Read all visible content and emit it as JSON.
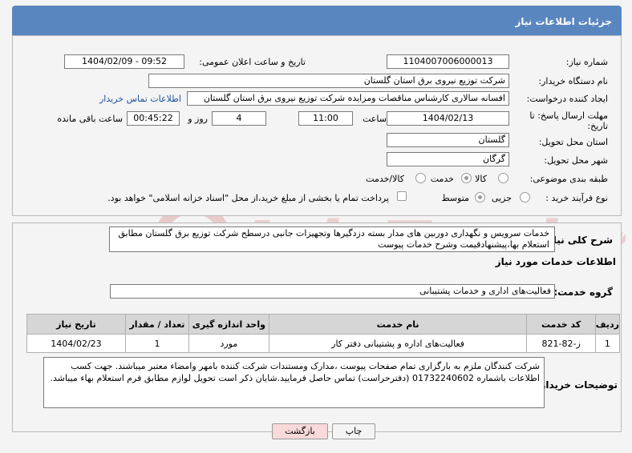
{
  "header": {
    "title": "جزئیات اطلاعات نیاز"
  },
  "form": {
    "need_number_label": "شماره نیاز:",
    "need_number": "1104007006000013",
    "announce_label": "تاریخ و ساعت اعلان عمومی:",
    "announce_value": "1404/02/09 - 09:52",
    "buyer_label": "نام دستگاه خریدار:",
    "buyer_value": "شرکت توزیع نیروی برق استان گلستان",
    "creator_label": "ایجاد کننده درخواست:",
    "creator_value": "افسانه سالاری کارشناس مناقصات ومزایده شرکت توزیع نیروی برق استان گلستان",
    "contact_link": "اطلاعات تماس خریدار",
    "deadline_label_1": "مهلت ارسال پاسخ: تا",
    "deadline_label_2": "تاریخ:",
    "deadline_date": "1404/02/13",
    "time_label": "ساعت",
    "deadline_time": "11:00",
    "days_value": "4",
    "days_label": "روز و",
    "remaining_time": "00:45:22",
    "remaining_label": "ساعت باقی مانده",
    "province_label": "استان محل تحویل:",
    "province_value": "گلستان",
    "city_label": "شهر محل تحویل:",
    "city_value": "گرگان",
    "category_label": "طبقه بندی موضوعی:",
    "category_options": [
      "کالا",
      "خدمت",
      "کالا/خدمت"
    ],
    "process_label": "نوع فرآیند خرید :",
    "process_options": [
      "جزیی",
      "متوسط"
    ],
    "payment_note": "پرداخت تمام یا بخشی از مبلغ خرید،از محل \"اسناد خزانه اسلامی\" خواهد بود."
  },
  "general": {
    "label": "شرح کلی نیاز:",
    "text": "خدمات سرویس و نگهداری دوربین های مدار بسته  دزدگیرها وتجهیزات جانبی درسطح شرکت توزیع برق گلستان مطابق استعلام بها،پیشنهادقیمت وشرح خدمات پیوست"
  },
  "services": {
    "section_title": "اطلاعات خدمات مورد نیاز",
    "group_label": "گروه خدمت:",
    "group_value": "فعالیت‌های اداری و خدمات پشتیبانی",
    "columns": [
      "ردیف",
      "کد خدمت",
      "نام خدمت",
      "واحد اندازه گیری",
      "تعداد / مقدار",
      "تاریخ نیاز"
    ],
    "rows": [
      [
        "1",
        "ز-82-821",
        "فعالیت‌های اداره و پشتیبانی دفتر کار",
        "مورد",
        "1",
        "1404/02/23"
      ]
    ]
  },
  "notes": {
    "label": "توضیحات خریدار:",
    "text": "شرکت کنندگان ملزم به بارگزاری تمام صفحات پیوست ،مدارک ومستندات شرکت کننده بامهر وامضاء معتبر میباشند. جهت کسب اطلاعات باشماره 01732240602 (دفترحراست) تماس حاصل فرمایید.شایان ذکر است تحویل لوازم مطابق فرم استعلام بهاء میباشد."
  },
  "buttons": {
    "print": "چاپ",
    "back": "بازگشت"
  },
  "colors": {
    "header": "#5a86c0",
    "link": "#1a4f9c",
    "back_button": "#f9d9d9"
  }
}
